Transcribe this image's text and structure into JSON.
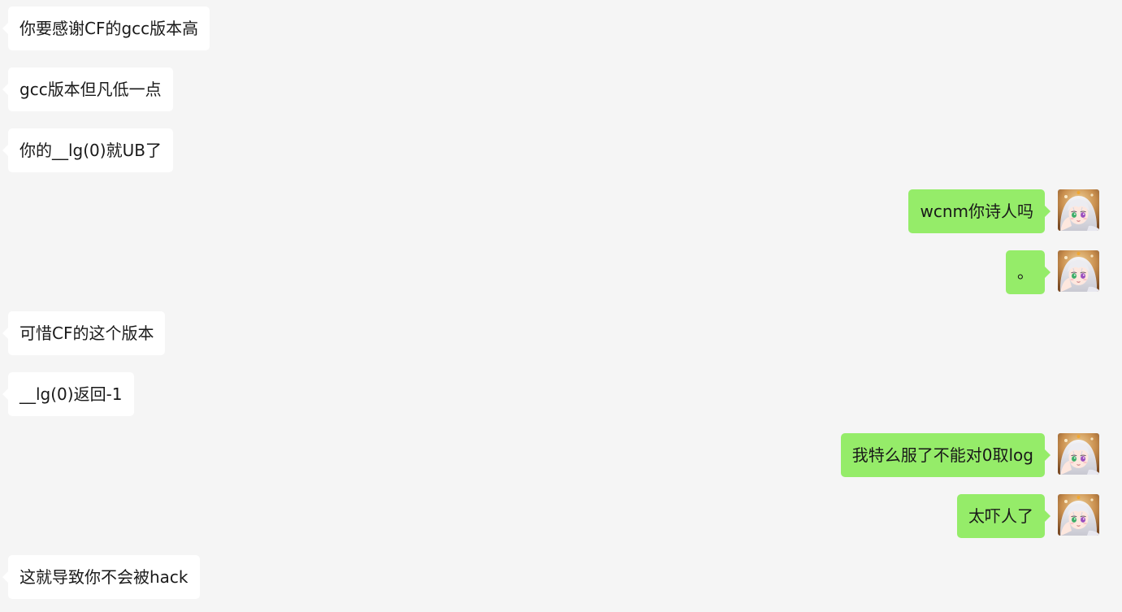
{
  "messages": [
    {
      "side": "in",
      "text": "你要感谢CF的gcc版本高"
    },
    {
      "side": "in",
      "text": "gcc版本但凡低一点"
    },
    {
      "side": "in",
      "text": "你的__lg(0)就UB了"
    },
    {
      "side": "out",
      "text": "wcnm你诗人吗"
    },
    {
      "side": "out",
      "text": "。"
    },
    {
      "side": "in",
      "text": "可惜CF的这个版本"
    },
    {
      "side": "in",
      "text": "__lg(0)返回-1"
    },
    {
      "side": "out",
      "text": "我特么服了不能对0取log"
    },
    {
      "side": "out",
      "text": "太吓人了"
    },
    {
      "side": "in",
      "text": "这就导致你不会被hack"
    }
  ],
  "avatar": {
    "icon": "anime-girl-avatar-icon"
  },
  "colors": {
    "background": "#f5f5f5",
    "incoming_bubble": "#ffffff",
    "outgoing_bubble": "#95ec69",
    "text": "#191919"
  }
}
